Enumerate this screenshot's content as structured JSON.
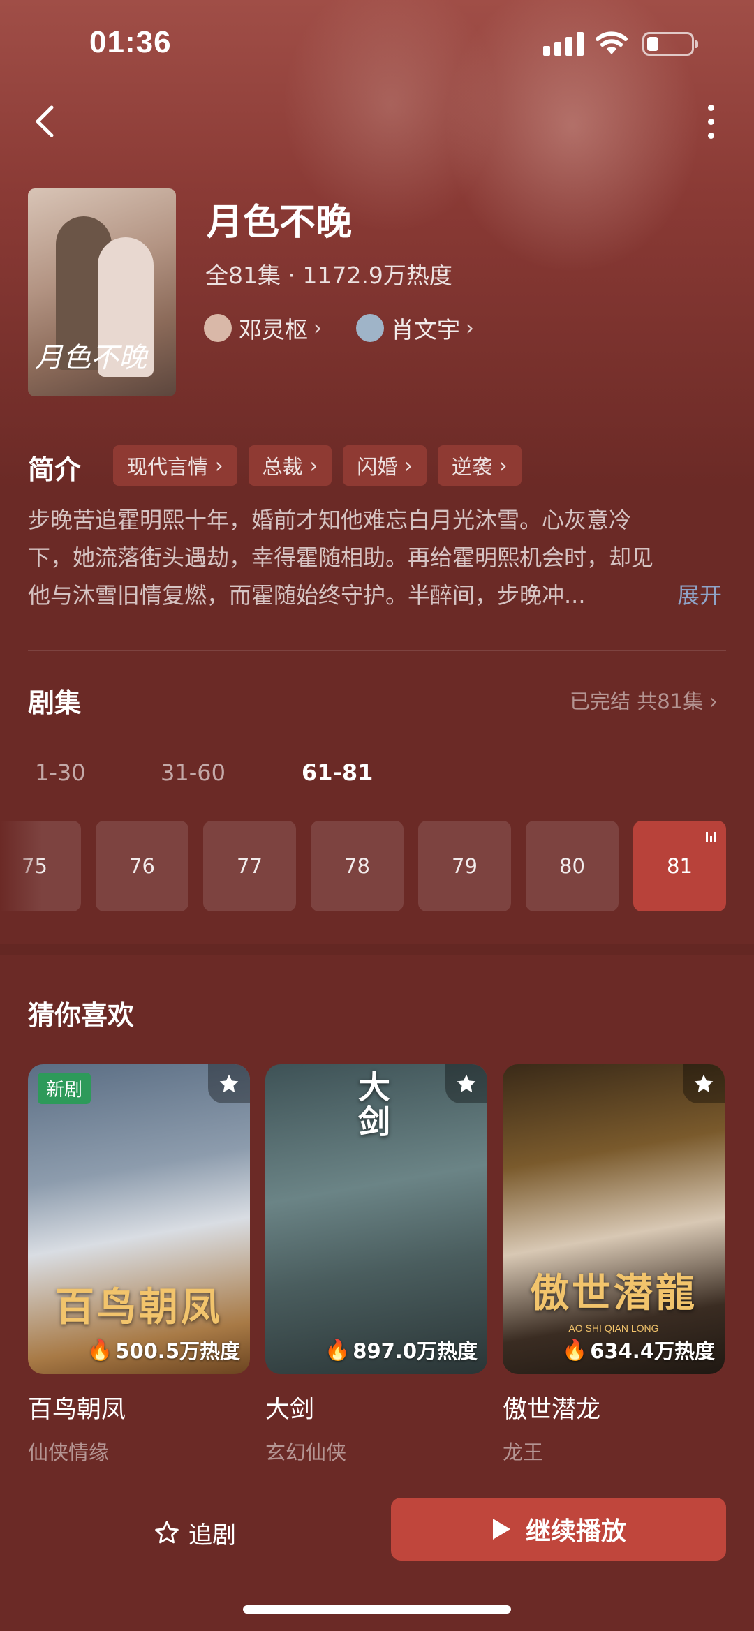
{
  "status_bar": {
    "time": "01:36"
  },
  "drama": {
    "poster_title": "月色不晚",
    "title": "月色不晚",
    "meta": "全81集 · 1172.9万热度",
    "cast": [
      {
        "name": "邓灵枢",
        "avatar_color": "#d9b8a8"
      },
      {
        "name": "肖文宇",
        "avatar_color": "#9fb4c8"
      }
    ]
  },
  "synopsis": {
    "label": "简介",
    "tags": [
      "现代言情",
      "总裁",
      "闪婚",
      "逆袭"
    ],
    "lines": [
      "步晚苦追霍明熙十年，婚前才知他难忘白月光沐雪。心灰意冷",
      "下，她流落街头遇劫，幸得霍随相助。再给霍明熙机会时，却见",
      "他与沐雪旧情复燃，而霍随始终守护。半醉间，步晚冲..."
    ],
    "expand_label": "展开"
  },
  "episodes": {
    "label": "剧集",
    "status": "已完结 共81集",
    "ranges": [
      "1-30",
      "31-60",
      "61-81"
    ],
    "active_range": "61-81",
    "items": [
      "75",
      "76",
      "77",
      "78",
      "79",
      "80",
      "81"
    ],
    "current": "81"
  },
  "recommendations": {
    "label": "猜你喜欢",
    "items": [
      {
        "cover_text": "百鸟朝凤",
        "badge": "新剧",
        "heat": "500.5万热度",
        "name": "百鸟朝凤",
        "genre": "仙侠情缘"
      },
      {
        "cover_text": "大剑",
        "heat": "897.0万热度",
        "name": "大剑",
        "genre": "玄幻仙侠"
      },
      {
        "cover_text": "傲世潜龍",
        "cover_subtext": "AO SHI QIAN LONG",
        "heat": "634.4万热度",
        "name": "傲世潜龙",
        "genre": "龙王"
      }
    ]
  },
  "bottom": {
    "follow_label": "追剧",
    "play_label": "继续播放"
  },
  "colors": {
    "background": "#6b2a26",
    "accent": "#c0463c",
    "tag_bg": "#8f3a33",
    "link": "#8fa4c8",
    "new_badge": "#2d9a5a"
  }
}
